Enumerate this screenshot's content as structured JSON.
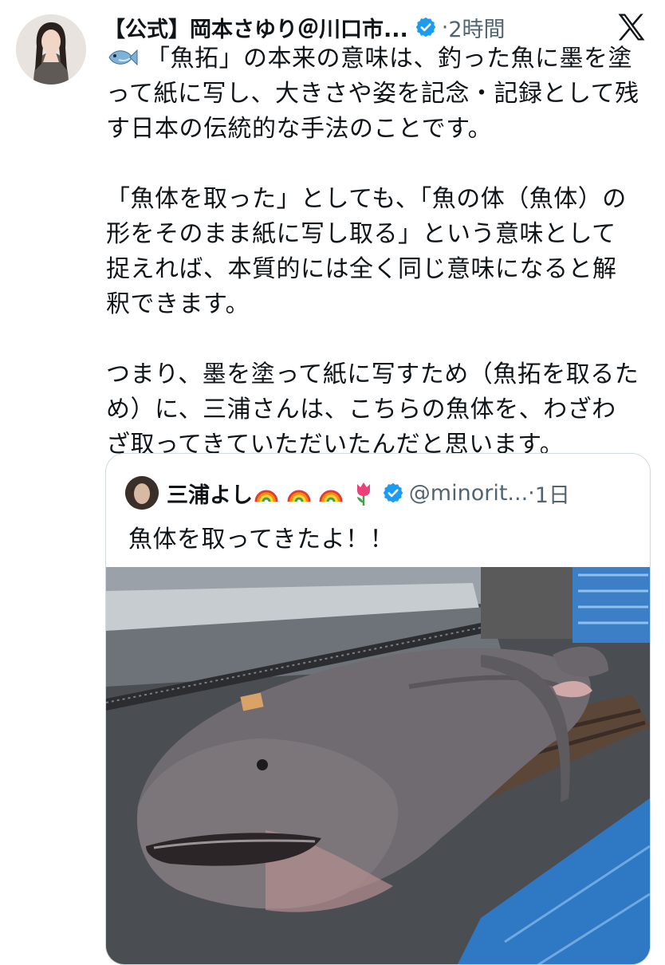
{
  "tweet": {
    "author_name": "【公式】岡本さゆり＠川口市...",
    "separator": "·",
    "time": "2時間",
    "paragraphs": [
      "「魚拓」の本来の意味は、釣った魚に墨を塗って紙に写し、大きさや姿を記念・記録として残す日本の伝統的な手法のことです。",
      "「魚体を取った」としても、「魚の体（魚体）の形をそのまま紙に写し取る」という意味として捉えれば、本質的には全く同じ意味になると解釈できます。",
      "つまり、墨を塗って紙に写すため（魚拓を取るため）に、三浦さんは、こちらの魚体を、わざわざ取ってきていただいたんだと思います。"
    ]
  },
  "quote": {
    "author_name": "三浦よし",
    "handle": "@minorit...",
    "separator": "·",
    "time": "1日",
    "text": "魚体を取ってきたよ！！"
  },
  "icons": {
    "tweet_prefix": "fish-icon",
    "verified": "verified-badge-icon",
    "platform": "x-logo-icon",
    "name_suffix": [
      "rainbow-icon",
      "rainbow-icon",
      "rainbow-icon",
      "tulip-icon"
    ]
  },
  "colors": {
    "text": "#0f1419",
    "secondary": "#536471",
    "verified": "#1d9bf0",
    "border": "#cfd9de"
  }
}
